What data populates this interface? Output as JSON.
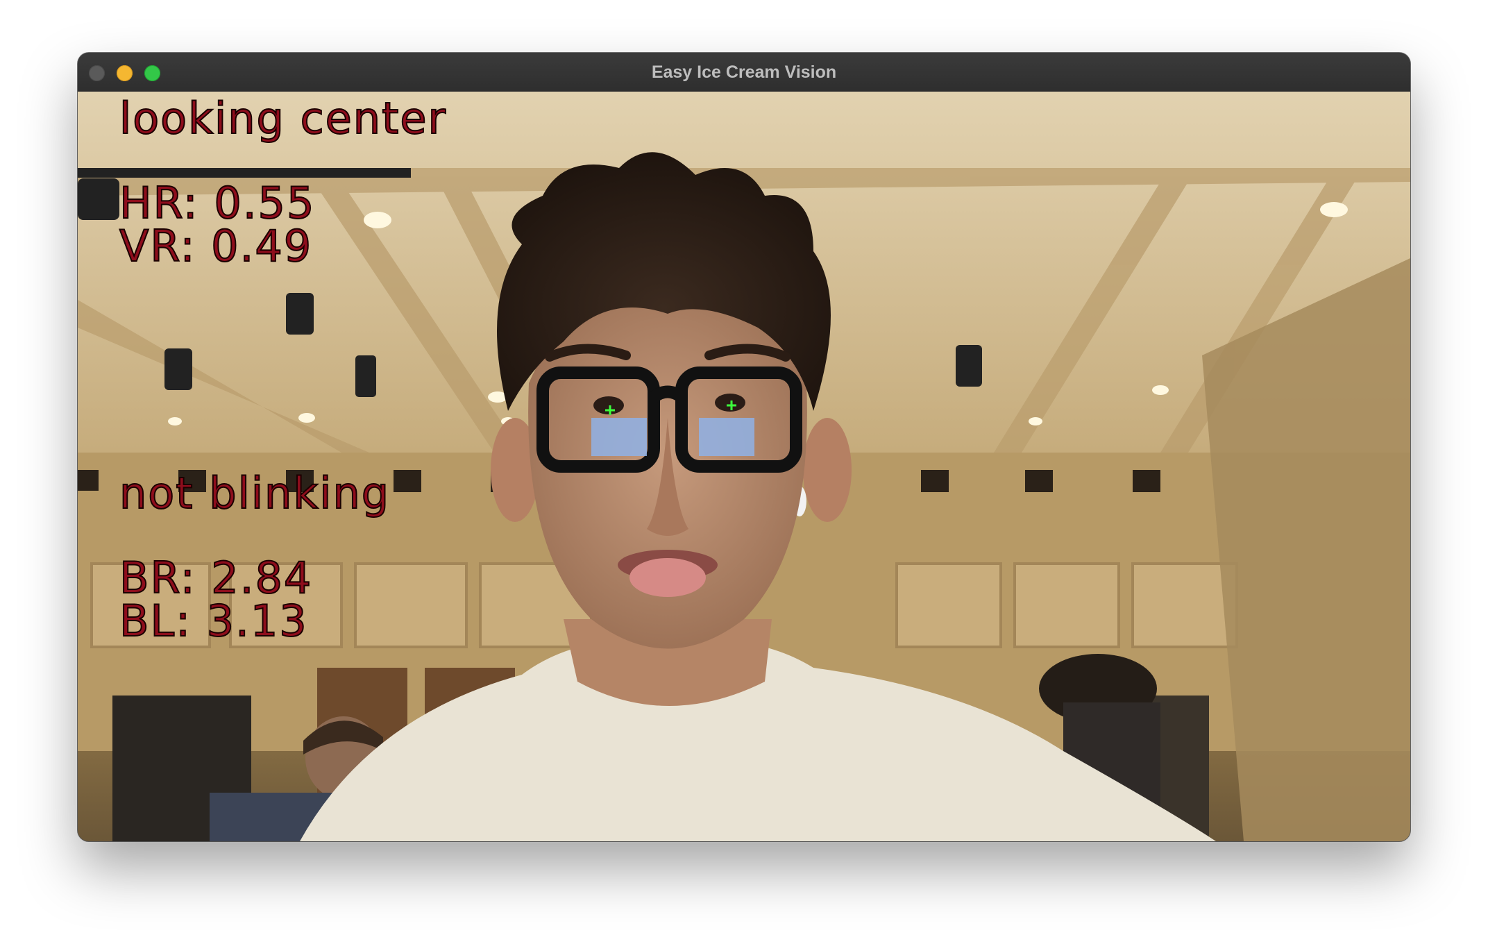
{
  "window": {
    "title": "Easy Ice Cream Vision"
  },
  "overlay": {
    "gaze_status": "looking center",
    "hr": "HR: 0.55",
    "vr": "VR: 0.49",
    "blink_status": "not blinking",
    "br": "BR: 2.84",
    "bl": "BL: 3.13"
  },
  "colors": {
    "overlay_text": "#8e0d1c",
    "pupil_marker": "#3cff3c",
    "close_button": "#5a5a5a",
    "minimize_button": "#f5b731",
    "zoom_button": "#33c748"
  }
}
